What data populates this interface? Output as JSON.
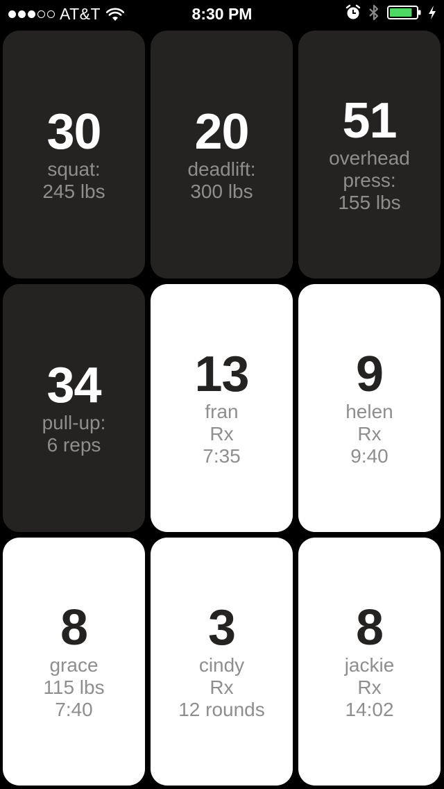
{
  "status_bar": {
    "carrier": "AT&T",
    "time": "8:30 PM",
    "signal_bars_filled": 3,
    "signal_bars_total": 5,
    "battery_level": 0.85,
    "icons": [
      "wifi-icon",
      "alarm-icon",
      "bluetooth-icon",
      "battery-icon",
      "charging-bolt-icon"
    ]
  },
  "colors": {
    "dark_tile": "#252321",
    "light_tile": "#ffffff",
    "label_gray": "#8e8e8e",
    "battery_green": "#4cd964"
  },
  "tiles": [
    {
      "number": "30",
      "lines": [
        "squat:",
        "245 lbs"
      ],
      "theme": "dark"
    },
    {
      "number": "20",
      "lines": [
        "deadlift:",
        "300 lbs"
      ],
      "theme": "dark"
    },
    {
      "number": "51",
      "lines": [
        "overhead",
        "press:",
        "155 lbs"
      ],
      "theme": "dark"
    },
    {
      "number": "34",
      "lines": [
        "pull-up:",
        "6 reps"
      ],
      "theme": "dark"
    },
    {
      "number": "13",
      "lines": [
        "fran",
        "Rx",
        "7:35"
      ],
      "theme": "light"
    },
    {
      "number": "9",
      "lines": [
        "helen",
        "Rx",
        "9:40"
      ],
      "theme": "light"
    },
    {
      "number": "8",
      "lines": [
        "grace",
        "115 lbs",
        "7:40"
      ],
      "theme": "light"
    },
    {
      "number": "3",
      "lines": [
        "cindy",
        "Rx",
        "12 rounds"
      ],
      "theme": "light"
    },
    {
      "number": "8",
      "lines": [
        "jackie",
        "Rx",
        "14:02"
      ],
      "theme": "light"
    }
  ]
}
